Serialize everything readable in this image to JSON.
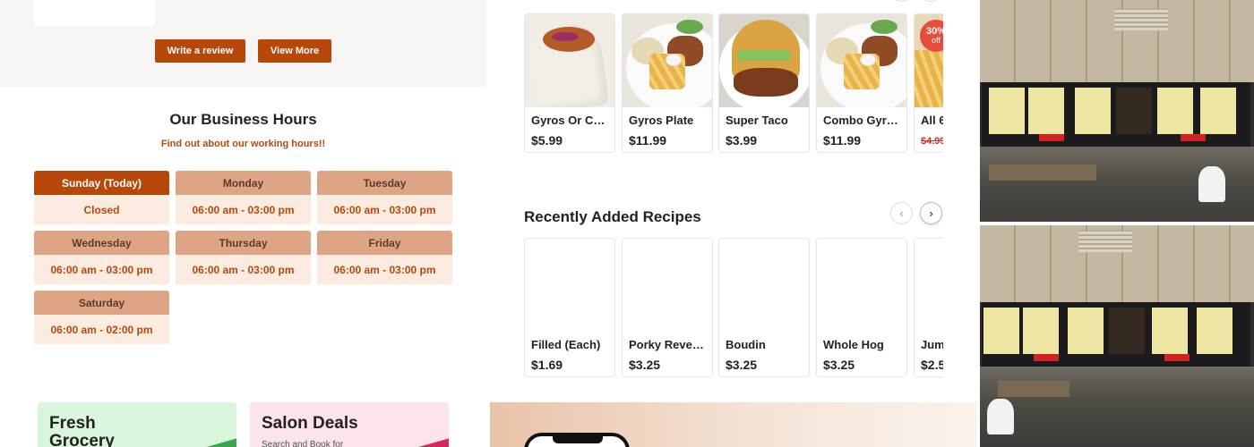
{
  "review": {
    "write_review_label": "Write a review",
    "view_more_label": "View More"
  },
  "hours": {
    "title": "Our Business Hours",
    "subtitle": "Find out about our working hours!!",
    "days": [
      {
        "day": "Sunday (Today)",
        "time": "Closed",
        "today": true
      },
      {
        "day": "Monday",
        "time": "06:00 am - 03:00 pm"
      },
      {
        "day": "Tuesday",
        "time": "06:00 am - 03:00 pm"
      },
      {
        "day": "Wednesday",
        "time": "06:00 am - 03:00 pm"
      },
      {
        "day": "Thursday",
        "time": "06:00 am - 03:00 pm"
      },
      {
        "day": "Friday",
        "time": "06:00 am - 03:00 pm"
      },
      {
        "day": "Saturday",
        "time": "06:00 am - 02:00 pm"
      }
    ]
  },
  "promos": {
    "grocery_title": "Fresh Grocery",
    "salon_title": "Salon Deals",
    "salon_text": "Search and Book for"
  },
  "menu_items": [
    {
      "name": "Gyros Or Chicken Gyros",
      "price": "$5.99"
    },
    {
      "name": "Gyros Plate",
      "price": "$11.99"
    },
    {
      "name": "Super Taco",
      "price": "$3.99"
    },
    {
      "name": "Combo Gyros Plate",
      "price": "$11.99"
    },
    {
      "name": "All 6",
      "price": "$4.99",
      "badge_pct": "30%",
      "badge_text": "off"
    }
  ],
  "recipes": {
    "title": "Recently Added Recipes",
    "prev_icon": "chevron-left-icon",
    "next_icon": "chevron-right-icon",
    "items": [
      {
        "name": "Filled (Each)",
        "price": "$1.69"
      },
      {
        "name": "Porky Revenge",
        "price": "$3.25"
      },
      {
        "name": "Boudin",
        "price": "$3.25"
      },
      {
        "name": "Whole Hog",
        "price": "$3.25"
      },
      {
        "name": "Jum",
        "price": "$2.5"
      }
    ]
  },
  "colors": {
    "accent": "#b8480a",
    "day_header": "#dea585",
    "day_body": "#fbebe1",
    "badge": "#e74c3c"
  }
}
